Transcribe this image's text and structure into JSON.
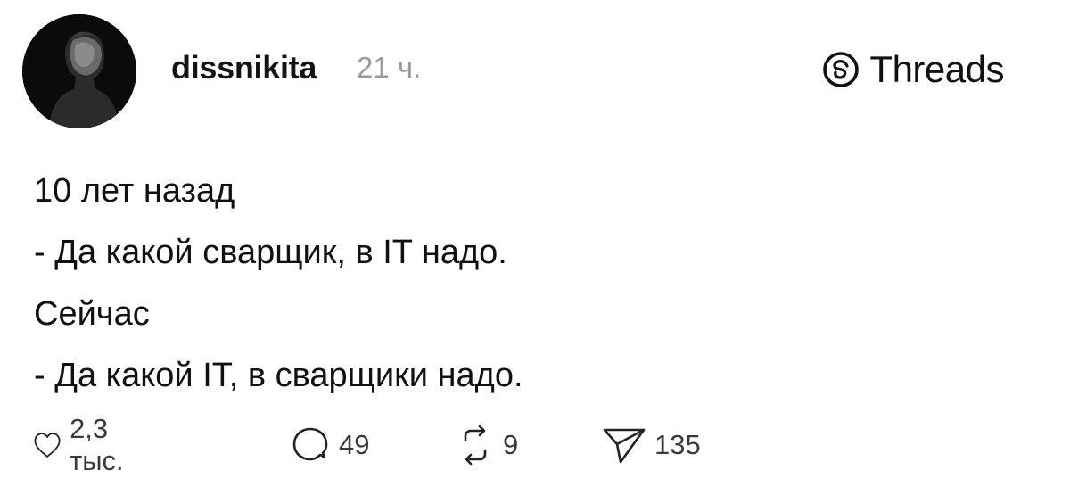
{
  "post": {
    "username": "dissnikita",
    "timestamp": "21 ч.",
    "brand": {
      "name": "Threads",
      "logo_icon": "threads-logo-icon"
    },
    "avatar_icon": "profile-photo",
    "lines": [
      "10 лет назад",
      "- Да какой сварщик, в IT надо.",
      "Сейчас",
      "- Да какой IT, в сварщики надо."
    ],
    "actions": {
      "likes": {
        "icon": "heart-icon",
        "count": "2,3 тыс."
      },
      "replies": {
        "icon": "comment-icon",
        "count": "49"
      },
      "reposts": {
        "icon": "repost-icon",
        "count": "9"
      },
      "shares": {
        "icon": "send-icon",
        "count": "135"
      }
    }
  }
}
